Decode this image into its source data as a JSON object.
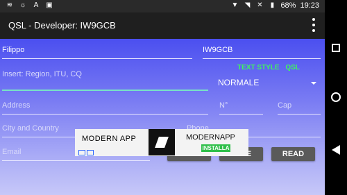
{
  "status_bar": {
    "battery_percent": "68%",
    "time": "19:23",
    "left_icons": [
      "wifi-icon",
      "brightness-icon",
      "translate-icon",
      "clipboard-icon"
    ],
    "right_icons": [
      "signal-icon",
      "wifi-icon",
      "close-icon",
      "battery-icon"
    ]
  },
  "app_bar": {
    "title": "QSL - Developer: IW9GCB"
  },
  "form": {
    "name_value": "Filippo",
    "callsign_value": "IW9GCB",
    "region_placeholder": "Insert: Region, ITU, CQ",
    "address_placeholder": "Address",
    "number_placeholder": "N°",
    "cap_placeholder": "Cap",
    "city_placeholder": "City and Country",
    "phone_placeholder": "Phone",
    "email_placeholder": "Email"
  },
  "text_style": {
    "label": "TEXT STYLE",
    "suffix": "QSL",
    "selected": "NORMALE"
  },
  "buttons": {
    "backgr": "BACKGR",
    "save": "SAVE",
    "read": "READ"
  },
  "ad": {
    "brand_left": "MODERN APP",
    "brand_name": "MODERNAPP",
    "install_label": "INSTALLA"
  },
  "colors": {
    "accent_green": "#3ff55d",
    "active_underline": "#78e2c6",
    "button_bg": "#5a5a5a"
  }
}
